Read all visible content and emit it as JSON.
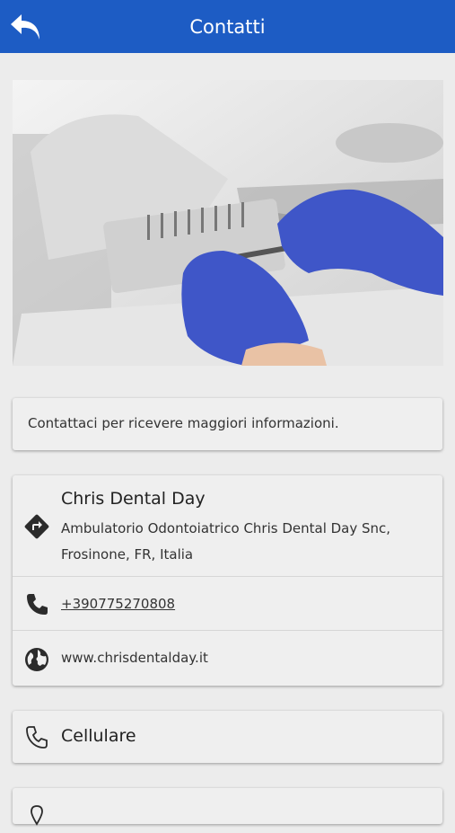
{
  "header": {
    "title": "Contatti",
    "back_icon": "back-arrow-icon"
  },
  "hero": {
    "image": "dental-instruments-photo"
  },
  "intro": {
    "text": "Contattaci per ricevere maggiori informazioni."
  },
  "contact": {
    "name": "Chris Dental Day",
    "address": "Ambulatorio Odontoiatrico Chris Dental Day Snc, Frosinone, FR, Italia",
    "phone": "+390775270808",
    "website": "www.chrisdentalday.it"
  },
  "mobile": {
    "label": "Cellulare"
  },
  "colors": {
    "accent": "#1d5cc4",
    "background": "#ececec",
    "card": "#efefef"
  }
}
